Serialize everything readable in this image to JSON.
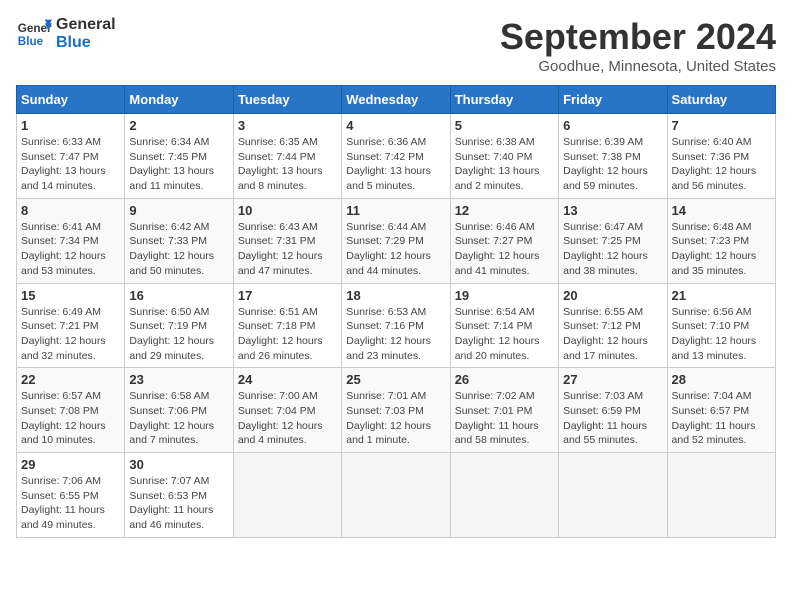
{
  "header": {
    "logo_line1": "General",
    "logo_line2": "Blue",
    "title": "September 2024",
    "subtitle": "Goodhue, Minnesota, United States"
  },
  "weekdays": [
    "Sunday",
    "Monday",
    "Tuesday",
    "Wednesday",
    "Thursday",
    "Friday",
    "Saturday"
  ],
  "weeks": [
    [
      {
        "day": "1",
        "info": "Sunrise: 6:33 AM\nSunset: 7:47 PM\nDaylight: 13 hours\nand 14 minutes."
      },
      {
        "day": "2",
        "info": "Sunrise: 6:34 AM\nSunset: 7:45 PM\nDaylight: 13 hours\nand 11 minutes."
      },
      {
        "day": "3",
        "info": "Sunrise: 6:35 AM\nSunset: 7:44 PM\nDaylight: 13 hours\nand 8 minutes."
      },
      {
        "day": "4",
        "info": "Sunrise: 6:36 AM\nSunset: 7:42 PM\nDaylight: 13 hours\nand 5 minutes."
      },
      {
        "day": "5",
        "info": "Sunrise: 6:38 AM\nSunset: 7:40 PM\nDaylight: 13 hours\nand 2 minutes."
      },
      {
        "day": "6",
        "info": "Sunrise: 6:39 AM\nSunset: 7:38 PM\nDaylight: 12 hours\nand 59 minutes."
      },
      {
        "day": "7",
        "info": "Sunrise: 6:40 AM\nSunset: 7:36 PM\nDaylight: 12 hours\nand 56 minutes."
      }
    ],
    [
      {
        "day": "8",
        "info": "Sunrise: 6:41 AM\nSunset: 7:34 PM\nDaylight: 12 hours\nand 53 minutes."
      },
      {
        "day": "9",
        "info": "Sunrise: 6:42 AM\nSunset: 7:33 PM\nDaylight: 12 hours\nand 50 minutes."
      },
      {
        "day": "10",
        "info": "Sunrise: 6:43 AM\nSunset: 7:31 PM\nDaylight: 12 hours\nand 47 minutes."
      },
      {
        "day": "11",
        "info": "Sunrise: 6:44 AM\nSunset: 7:29 PM\nDaylight: 12 hours\nand 44 minutes."
      },
      {
        "day": "12",
        "info": "Sunrise: 6:46 AM\nSunset: 7:27 PM\nDaylight: 12 hours\nand 41 minutes."
      },
      {
        "day": "13",
        "info": "Sunrise: 6:47 AM\nSunset: 7:25 PM\nDaylight: 12 hours\nand 38 minutes."
      },
      {
        "day": "14",
        "info": "Sunrise: 6:48 AM\nSunset: 7:23 PM\nDaylight: 12 hours\nand 35 minutes."
      }
    ],
    [
      {
        "day": "15",
        "info": "Sunrise: 6:49 AM\nSunset: 7:21 PM\nDaylight: 12 hours\nand 32 minutes."
      },
      {
        "day": "16",
        "info": "Sunrise: 6:50 AM\nSunset: 7:19 PM\nDaylight: 12 hours\nand 29 minutes."
      },
      {
        "day": "17",
        "info": "Sunrise: 6:51 AM\nSunset: 7:18 PM\nDaylight: 12 hours\nand 26 minutes."
      },
      {
        "day": "18",
        "info": "Sunrise: 6:53 AM\nSunset: 7:16 PM\nDaylight: 12 hours\nand 23 minutes."
      },
      {
        "day": "19",
        "info": "Sunrise: 6:54 AM\nSunset: 7:14 PM\nDaylight: 12 hours\nand 20 minutes."
      },
      {
        "day": "20",
        "info": "Sunrise: 6:55 AM\nSunset: 7:12 PM\nDaylight: 12 hours\nand 17 minutes."
      },
      {
        "day": "21",
        "info": "Sunrise: 6:56 AM\nSunset: 7:10 PM\nDaylight: 12 hours\nand 13 minutes."
      }
    ],
    [
      {
        "day": "22",
        "info": "Sunrise: 6:57 AM\nSunset: 7:08 PM\nDaylight: 12 hours\nand 10 minutes."
      },
      {
        "day": "23",
        "info": "Sunrise: 6:58 AM\nSunset: 7:06 PM\nDaylight: 12 hours\nand 7 minutes."
      },
      {
        "day": "24",
        "info": "Sunrise: 7:00 AM\nSunset: 7:04 PM\nDaylight: 12 hours\nand 4 minutes."
      },
      {
        "day": "25",
        "info": "Sunrise: 7:01 AM\nSunset: 7:03 PM\nDaylight: 12 hours\nand 1 minute."
      },
      {
        "day": "26",
        "info": "Sunrise: 7:02 AM\nSunset: 7:01 PM\nDaylight: 11 hours\nand 58 minutes."
      },
      {
        "day": "27",
        "info": "Sunrise: 7:03 AM\nSunset: 6:59 PM\nDaylight: 11 hours\nand 55 minutes."
      },
      {
        "day": "28",
        "info": "Sunrise: 7:04 AM\nSunset: 6:57 PM\nDaylight: 11 hours\nand 52 minutes."
      }
    ],
    [
      {
        "day": "29",
        "info": "Sunrise: 7:06 AM\nSunset: 6:55 PM\nDaylight: 11 hours\nand 49 minutes."
      },
      {
        "day": "30",
        "info": "Sunrise: 7:07 AM\nSunset: 6:53 PM\nDaylight: 11 hours\nand 46 minutes."
      },
      {
        "day": "",
        "info": ""
      },
      {
        "day": "",
        "info": ""
      },
      {
        "day": "",
        "info": ""
      },
      {
        "day": "",
        "info": ""
      },
      {
        "day": "",
        "info": ""
      }
    ]
  ]
}
